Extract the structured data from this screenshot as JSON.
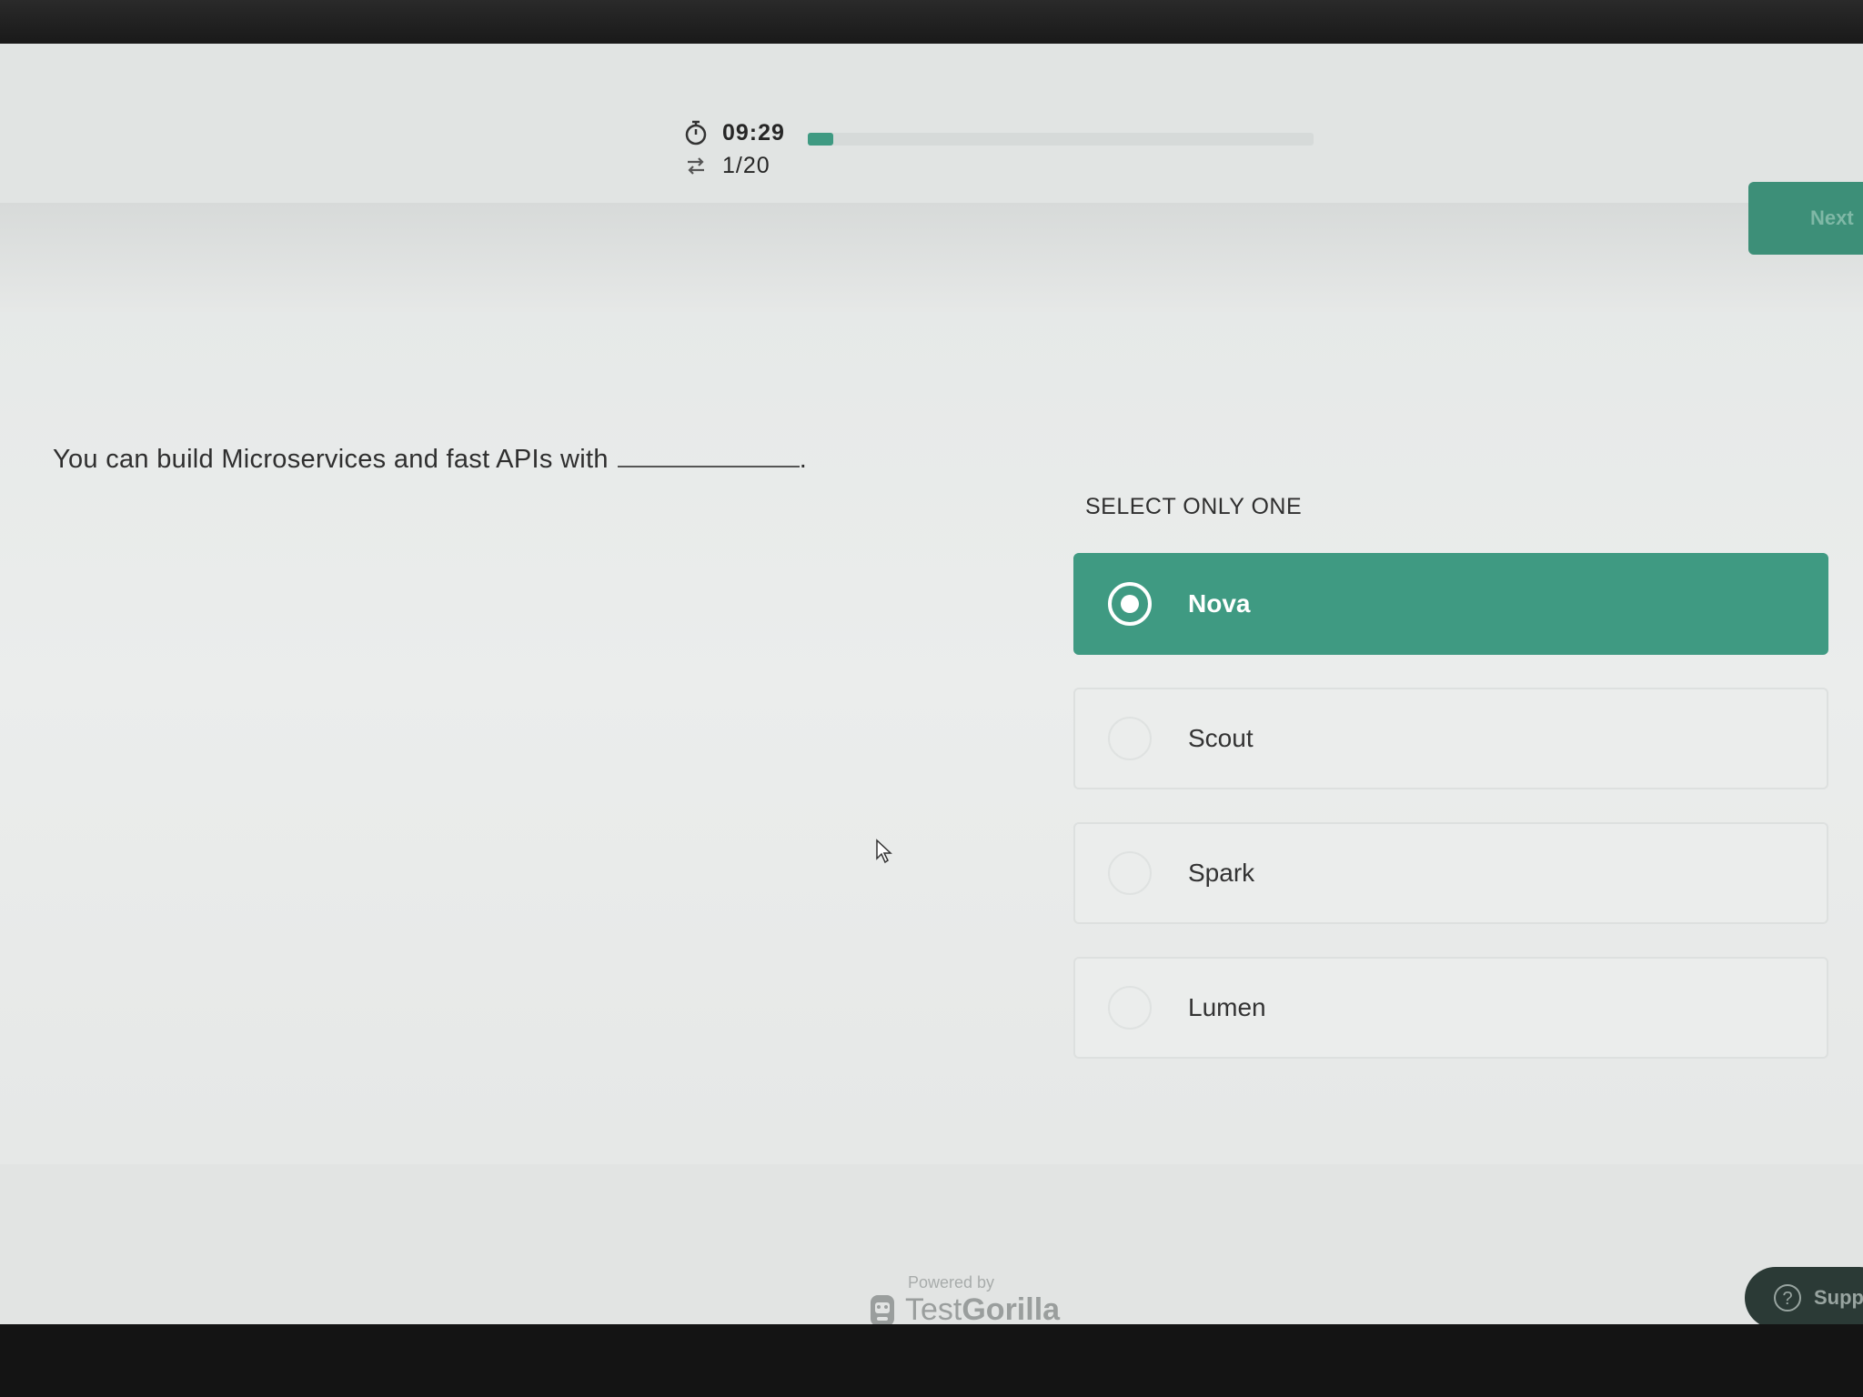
{
  "header": {
    "timer": "09:29",
    "question_counter": "1/20",
    "progress_fraction": 0.05,
    "next_label": "Next"
  },
  "question": {
    "text": "You can build Microservices and fast APIs with",
    "suffix": "."
  },
  "select_label": "SELECT ONLY ONE",
  "options": [
    {
      "label": "Nova",
      "selected": true
    },
    {
      "label": "Scout",
      "selected": false
    },
    {
      "label": "Spark",
      "selected": false
    },
    {
      "label": "Lumen",
      "selected": false
    }
  ],
  "footer": {
    "powered_by": "Powered by",
    "brand_part1": "Test",
    "brand_part2": "Gorilla",
    "support_label": "Supp"
  },
  "colors": {
    "accent": "#3f9a82",
    "next_button": "#3d8f78"
  }
}
